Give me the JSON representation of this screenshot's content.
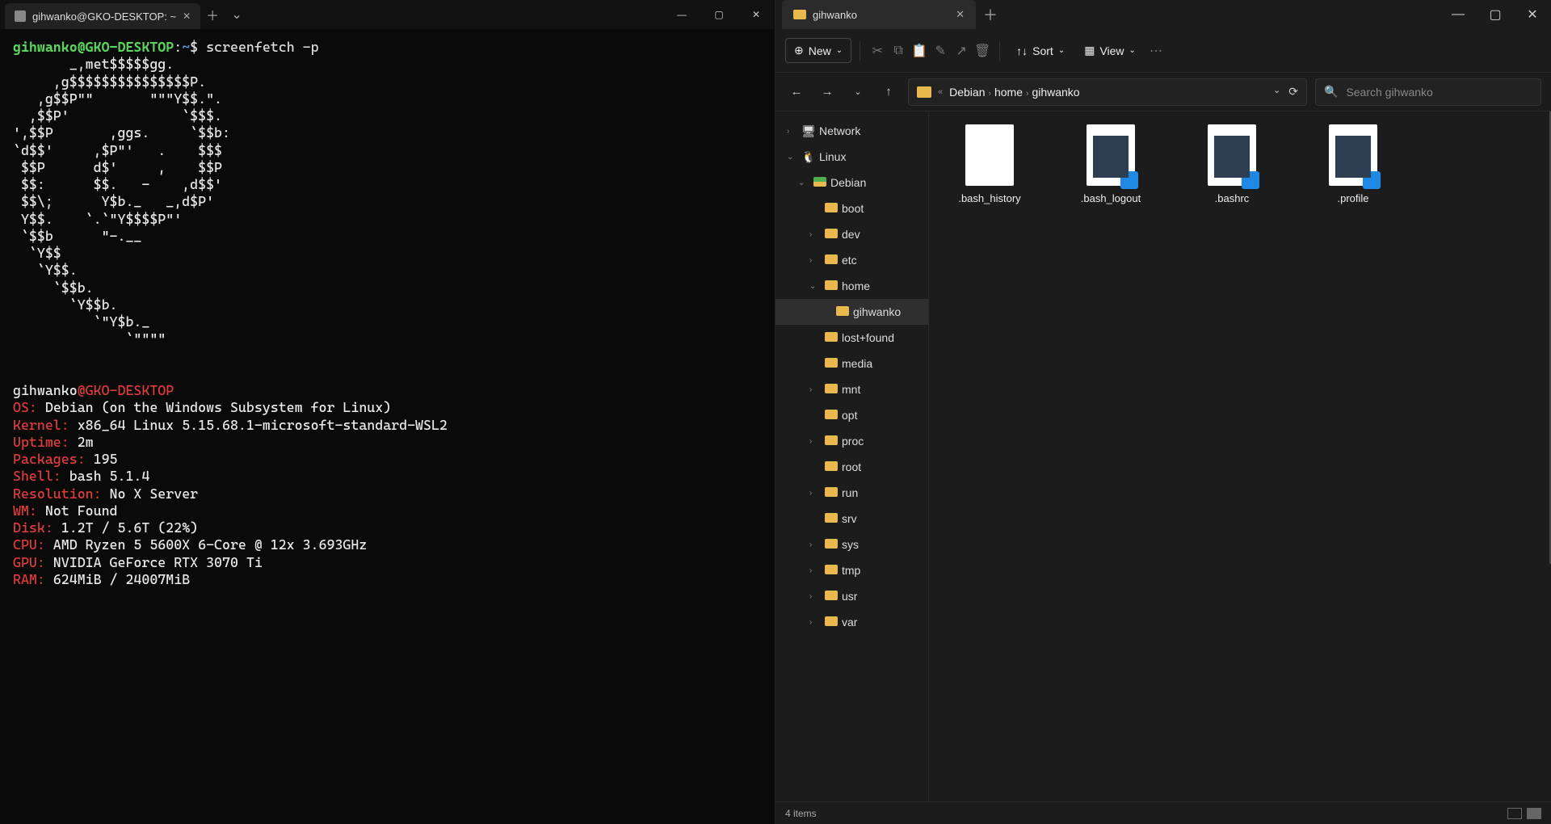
{
  "terminal": {
    "tab_title": "gihwanko@GKO-DESKTOP: ~",
    "prompt_user": "gihwanko@GKO-DESKTOP",
    "prompt_sep": ":",
    "prompt_path": "~",
    "prompt_sym": "$",
    "command": "screenfetch -p",
    "ascii": "       _,met$$$$$gg.\n     ,g$$$$$$$$$$$$$$$P.\n   ,g$$P\"\"       \"\"\"Y$$.\".\n  ,$$P'              `$$$.\n',$$P       ,ggs.     `$$b:\n`d$$'     ,$P\"'   .    $$$\n $$P      d$'     ,    $$P\n $$:      $$.   -    ,d$$'\n $$\\;      Y$b._   _,d$P'\n Y$$.    `.`\"Y$$$$P\"'\n `$$b      \"-.__\n  `Y$$\n   `Y$$.\n     `$$b.\n       `Y$$b.\n          `\"Y$b._\n              `\"\"\"\"",
    "sys_user": "gihwanko",
    "sys_at": "@",
    "sys_host": "GKO-DESKTOP",
    "info": [
      {
        "k": "OS:",
        "v": " Debian (on the Windows Subsystem for Linux)"
      },
      {
        "k": "Kernel:",
        "v": " x86_64 Linux 5.15.68.1-microsoft-standard-WSL2"
      },
      {
        "k": "Uptime:",
        "v": " 2m"
      },
      {
        "k": "Packages:",
        "v": " 195"
      },
      {
        "k": "Shell:",
        "v": " bash 5.1.4"
      },
      {
        "k": "Resolution:",
        "v": " No X Server"
      },
      {
        "k": "WM:",
        "v": " Not Found"
      },
      {
        "k": "Disk:",
        "v": " 1.2T / 5.6T (22%)"
      },
      {
        "k": "CPU:",
        "v": " AMD Ryzen 5 5600X 6-Core @ 12x 3.693GHz"
      },
      {
        "k": "GPU:",
        "v": " NVIDIA GeForce RTX 3070 Ti"
      },
      {
        "k": "RAM:",
        "v": " 624MiB / 24007MiB"
      }
    ]
  },
  "explorer": {
    "tab_title": "gihwanko",
    "toolbar": {
      "new_label": "New",
      "sort_label": "Sort",
      "view_label": "View"
    },
    "breadcrumb": [
      "Debian",
      "home",
      "gihwanko"
    ],
    "breadcrumb_prefix": "«",
    "search_placeholder": "Search gihwanko",
    "tree": [
      {
        "depth": 1,
        "chev": ">",
        "ico": "net",
        "label": "Network"
      },
      {
        "depth": 1,
        "chev": "v",
        "ico": "tux",
        "label": "Linux"
      },
      {
        "depth": 2,
        "chev": "v",
        "ico": "deb",
        "label": "Debian"
      },
      {
        "depth": 3,
        "chev": "",
        "ico": "f",
        "label": "boot"
      },
      {
        "depth": 3,
        "chev": ">",
        "ico": "f",
        "label": "dev"
      },
      {
        "depth": 3,
        "chev": ">",
        "ico": "f",
        "label": "etc"
      },
      {
        "depth": 3,
        "chev": "v",
        "ico": "f",
        "label": "home"
      },
      {
        "depth": 4,
        "chev": "",
        "ico": "f",
        "label": "gihwanko",
        "selected": true
      },
      {
        "depth": 3,
        "chev": "",
        "ico": "f",
        "label": "lost+found"
      },
      {
        "depth": 3,
        "chev": "",
        "ico": "f",
        "label": "media"
      },
      {
        "depth": 3,
        "chev": ">",
        "ico": "f",
        "label": "mnt"
      },
      {
        "depth": 3,
        "chev": "",
        "ico": "f",
        "label": "opt"
      },
      {
        "depth": 3,
        "chev": ">",
        "ico": "f",
        "label": "proc"
      },
      {
        "depth": 3,
        "chev": "",
        "ico": "f",
        "label": "root"
      },
      {
        "depth": 3,
        "chev": ">",
        "ico": "f",
        "label": "run"
      },
      {
        "depth": 3,
        "chev": "",
        "ico": "f",
        "label": "srv"
      },
      {
        "depth": 3,
        "chev": ">",
        "ico": "f",
        "label": "sys"
      },
      {
        "depth": 3,
        "chev": ">",
        "ico": "f",
        "label": "tmp"
      },
      {
        "depth": 3,
        "chev": ">",
        "ico": "f",
        "label": "usr"
      },
      {
        "depth": 3,
        "chev": ">",
        "ico": "f",
        "label": "var"
      }
    ],
    "files": [
      {
        "name": ".bash_history",
        "variant": "plain"
      },
      {
        "name": ".bash_logout",
        "variant": "vscode"
      },
      {
        "name": ".bashrc",
        "variant": "vscode"
      },
      {
        "name": ".profile",
        "variant": "vscode"
      }
    ],
    "status": "4 items"
  }
}
